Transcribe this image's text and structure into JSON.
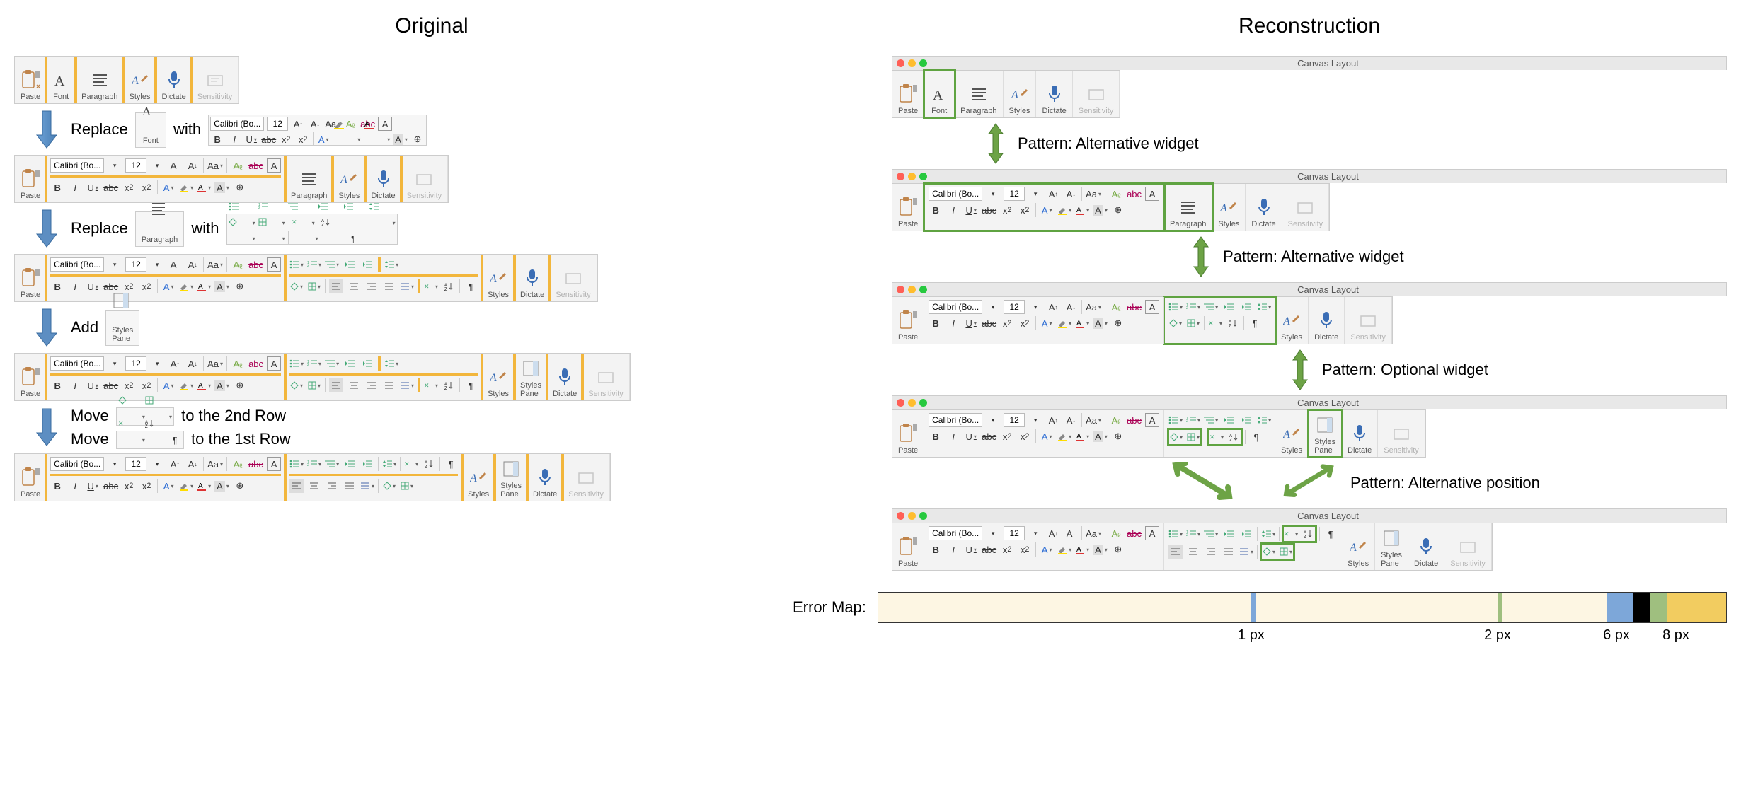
{
  "titles": {
    "original": "Original",
    "reconstruction": "Reconstruction"
  },
  "window_title": "Canvas Layout",
  "groups": {
    "paste": "Paste",
    "font": "Font",
    "paragraph": "Paragraph",
    "styles": "Styles",
    "styles_pane": "Styles\nPane",
    "dictate": "Dictate",
    "sensitivity": "Sensitivity"
  },
  "font_panel": {
    "family": "Calibri (Bo...",
    "size": "12"
  },
  "font_buttons_row1": [
    "A↑",
    "A↓",
    "Aa",
    "Aᵨ",
    "abc",
    "A"
  ],
  "font_buttons_row2": [
    "B",
    "I",
    "U",
    "abc",
    "x₂",
    "x²",
    "A",
    "✎",
    "A̲",
    "A",
    "⊕"
  ],
  "para_buttons_row1": [
    "≔",
    "≔",
    "≔",
    "≡",
    "≡",
    "≡"
  ],
  "para_buttons_row2": [
    "◇",
    "▦",
    "✕",
    "A↨↓",
    "¶"
  ],
  "para_buttons_r2a": [
    "≡",
    "≡",
    "≡",
    "≡",
    "≡"
  ],
  "para_buttons_r2b": [
    "◇",
    "▦"
  ],
  "steps": {
    "s1a": "Replace",
    "s1b": "with",
    "s2a": "Replace",
    "s2b": "with",
    "s3": "Add",
    "s4": "Move",
    "s4b": "to the 2nd Row",
    "s5": "Move",
    "s5b": "to the 1st Row"
  },
  "patterns": {
    "alt_widget": "Pattern: Alternative widget",
    "opt_widget": "Pattern: Optional widget",
    "alt_position": "Pattern: Alternative position"
  },
  "error_map": {
    "label": "Error Map:",
    "ticks": [
      "1 px",
      "2 px",
      "6 px",
      "8 px"
    ],
    "tick_positions_pct": [
      44,
      73,
      87,
      94
    ],
    "segments": [
      {
        "start": 0,
        "end": 44,
        "color": "#fdf6e3"
      },
      {
        "start": 44,
        "end": 44.5,
        "color": "#7da7d9"
      },
      {
        "start": 44.5,
        "end": 73,
        "color": "#fdf6e3"
      },
      {
        "start": 73,
        "end": 73.5,
        "color": "#9fbf7f"
      },
      {
        "start": 73.5,
        "end": 86,
        "color": "#fdf6e3"
      },
      {
        "start": 86,
        "end": 89,
        "color": "#7da7d9"
      },
      {
        "start": 89,
        "end": 91,
        "color": "#000"
      },
      {
        "start": 91,
        "end": 93,
        "color": "#9fbf7f"
      },
      {
        "start": 93,
        "end": 100,
        "color": "#f2cc60"
      }
    ]
  }
}
